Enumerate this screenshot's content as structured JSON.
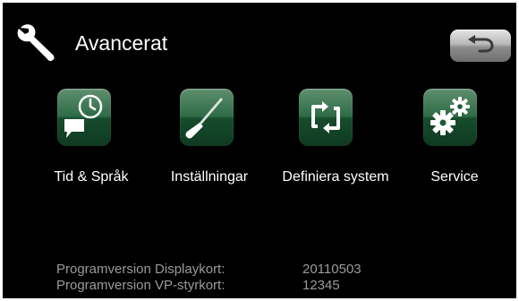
{
  "header": {
    "title": "Avancerat",
    "icon": "wrench-icon",
    "back_icon": "back-arrow-icon"
  },
  "tiles": [
    {
      "label": "Tid & Språk",
      "icon": "clock-speech-icon"
    },
    {
      "label": "Inställningar",
      "icon": "screwdriver-icon"
    },
    {
      "label": "Definiera system",
      "icon": "refresh-arrows-icon"
    },
    {
      "label": "Service",
      "icon": "gears-icon"
    }
  ],
  "versions": [
    {
      "label": "Programversion Displaykort:",
      "value": "20110503"
    },
    {
      "label": "Programversion VP-styrkort:",
      "value": "12345"
    }
  ],
  "colors": {
    "background": "#000000",
    "tile_green": "#2e6b46",
    "version_text": "#9a9a9a"
  }
}
